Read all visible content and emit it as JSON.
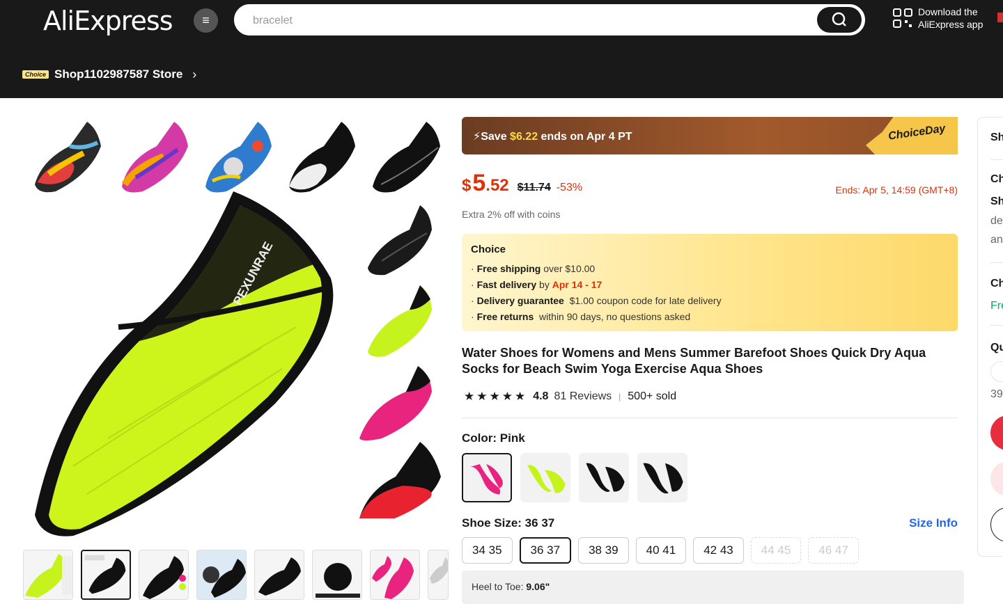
{
  "header": {
    "logo": "AliExpress",
    "search_placeholder": "bracelet",
    "download_line1": "Download the",
    "download_line2": "AliExpress app"
  },
  "store": {
    "badge": "Choice",
    "name": "Shop1102987587 Store"
  },
  "promo": {
    "prefix": "Save ",
    "amount": "$6.22",
    "suffix": " ends on Apr 4 PT",
    "tag": "ChoiceDay"
  },
  "price": {
    "currency": "$",
    "integer": "5",
    "decimal": ".52",
    "original": "$11.74",
    "discount": "-53%",
    "ends": "Ends: Apr 5, 14:59 (GMT+8)",
    "coins": "Extra 2% off with coins"
  },
  "choice": {
    "title": "Choice",
    "free_shipping": "Free shipping",
    "free_shipping_detail": " over $10.00",
    "fast_delivery": "Fast delivery",
    "fast_delivery_by": " by ",
    "fast_delivery_date": "Apr 14 - 17",
    "guarantee": "Delivery guarantee",
    "guarantee_detail": "$1.00 coupon code for late delivery",
    "returns": "Free returns",
    "returns_detail": "within 90 days, no questions asked"
  },
  "product": {
    "title": "Water Shoes for Womens and Mens Summer Barefoot Shoes Quick Dry Aqua Socks for Beach Swim Yoga Exercise Aqua Shoes",
    "rating": "4.8",
    "reviews": "81 Reviews",
    "sold": "500+ sold",
    "color_label": "Color: Pink",
    "size_label": "Shoe Size: 36 37",
    "size_info": "Size Info",
    "sizes": [
      "34 35",
      "36 37",
      "38 39",
      "40 41",
      "42 43",
      "44 45",
      "46 47"
    ],
    "heel_label": "Heel to Toe: ",
    "heel_value": "9.06\""
  },
  "side": {
    "t1": "Sh",
    "t2": "Ch",
    "t3": "Sh",
    "n1": "de",
    "n2": "an",
    "t4": "Ch",
    "g1": "Fre",
    "t5": "Qu",
    "n3": "39"
  },
  "colors": {
    "accent": "#e62e04",
    "link": "#2665e6",
    "header_bg": "#191919"
  }
}
